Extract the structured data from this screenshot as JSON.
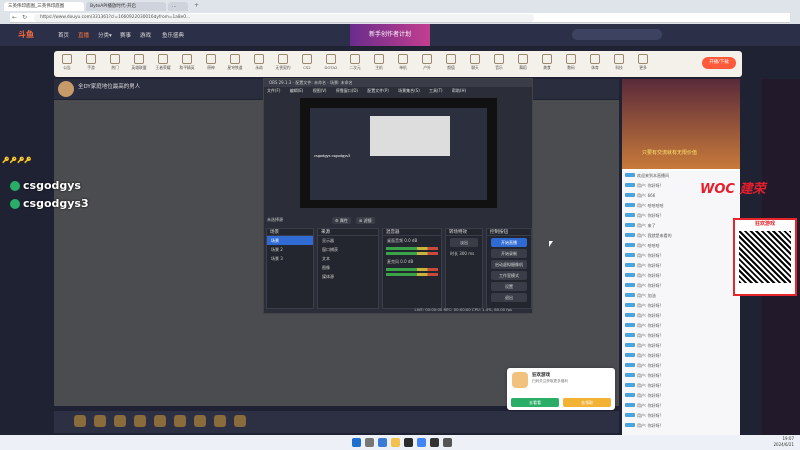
{
  "browser": {
    "tabs": [
      "三英伟印底图_三英伟印底图",
      "ByteAPI播放时代-开启",
      "…"
    ],
    "url": "https://www.douyu.com/331361?cl=1660922030016dyfrom=1a8e0...",
    "new_tab": "+"
  },
  "site": {
    "logo": "斗鱼",
    "nav": [
      "首页",
      "直播",
      "分类▾",
      "赛事",
      "游戏",
      "鱼乐盛典"
    ],
    "banner": "新手创作者计划",
    "kick_button": "开播/下载"
  },
  "categories": [
    "公告",
    "手游",
    "热门",
    "英雄联盟",
    "王者荣耀",
    "和平精英",
    "原神",
    "星穹铁道",
    "永劫",
    "无畏契约",
    "CS2",
    "DOTA2",
    "二次元",
    "主机",
    "单机",
    "户外",
    "颜值",
    "聊天",
    "音乐",
    "舞蹈",
    "美食",
    "数码",
    "体育",
    "科技",
    "更多"
  ],
  "room": {
    "streamer": "全DY家庭地位最高的男人",
    "meta": "●  ●"
  },
  "overlay": {
    "keys": "🔑🔑🔑🔑",
    "wechat_ids": [
      "csgodgys",
      "csgodgys3"
    ]
  },
  "obs": {
    "title": "OBS 29.1.3 - 配置文件: 未命名 - 场景: 未命名",
    "menu": [
      "文件(F)",
      "编辑(E)",
      "视图(V)",
      "停靠窗口(D)",
      "配置文件(P)",
      "场景集合(S)",
      "工具(T)",
      "帮助(H)"
    ],
    "no_source": "未选择源",
    "props": "⚙ 属性",
    "filters": "⊞ 滤镜",
    "docks": {
      "scenes": "场景",
      "sources": "来源",
      "mixer": "混音器",
      "transitions": "转场特效",
      "controls": "控制按钮"
    },
    "scenes": [
      "场景",
      "场景 2",
      "场景 3"
    ],
    "sources": [
      "显示器",
      "窗口捕获",
      "文本",
      "图像",
      "媒体源"
    ],
    "mixer": [
      {
        "name": "桌面音频",
        "db": "0.0 dB"
      },
      {
        "name": "麦克风",
        "db": "0.0 dB"
      }
    ],
    "transition": {
      "type": "淡出",
      "duration_label": "时长",
      "duration": "300 ms"
    },
    "controls": [
      "开始直播",
      "开始录制",
      "启动虚拟摄像机",
      "工作室模式",
      "设置",
      "退出"
    ],
    "status": "LIVE: 00:00:00    REC: 00:00:00    CPU: 1.4%, 60.00 fps",
    "preview_text": "csgodgys csgodgys3"
  },
  "rightcol": {
    "banner_text": "只要有交流就有无限价值",
    "logo": "WOC 建荣",
    "qr_title": "狂欢游戏"
  },
  "chat": [
    "欢迎来到本直播间",
    "用户: 你好呀!",
    "用户: 666",
    "用户: 哈哈哈哈",
    "用户: 你好呀!",
    "用户: 来了",
    "用户: 我就是来看的",
    "用户: 哈哈哈",
    "用户: 你好呀!",
    "用户: 你好呀!",
    "用户: 你好呀!",
    "用户: 你好呀!",
    "用户: 加油",
    "用户: 你好呀!",
    "用户: 你好呀!",
    "用户: 你好呀!",
    "用户: 你好呀!",
    "用户: 你好呀!",
    "用户: 你好呀!",
    "用户: 你好呀!",
    "用户: 你好呀!",
    "用户: 你好呀!",
    "用户: 你好呀!",
    "用户: 你好呀!",
    "用户: 你好呀!",
    "用户: 你好呀!"
  ],
  "popup": {
    "title": "狂欢游戏",
    "subtitle": "扫码关注获取更多福利",
    "btn_a": "去看看",
    "btn_b": "去领取"
  },
  "clock": {
    "time": "19:07",
    "date": "2024/6/21"
  }
}
